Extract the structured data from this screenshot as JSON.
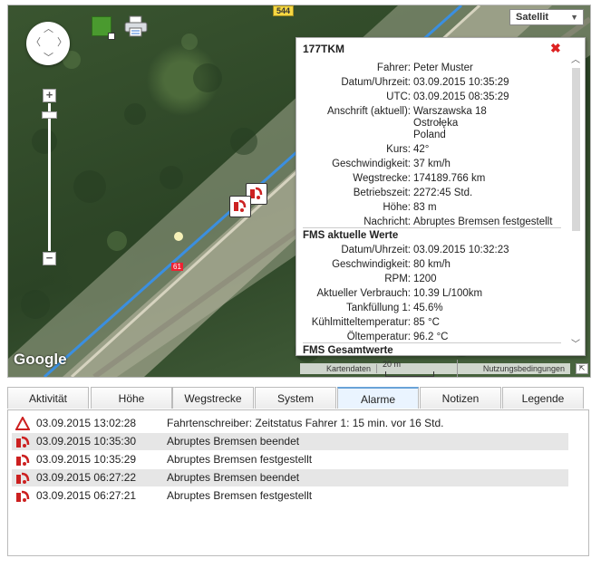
{
  "map": {
    "map_type": "Satellit",
    "road_label_top": "544",
    "road_label_mid": "61",
    "google_logo": "Google",
    "footer": {
      "map_data": "Kartendaten",
      "scale": "20 m",
      "terms": "Nutzungsbedingungen"
    },
    "icons": {
      "pan": "pan-control-icon",
      "zoom_in": "zoom-in-icon",
      "zoom_out": "zoom-out-icon",
      "color_tool": "color-square-icon",
      "print": "printer-icon",
      "vehicle": "harsh-braking-marker-icon"
    }
  },
  "popup": {
    "title": "177TKM",
    "close": "✖",
    "rows": [
      {
        "k": "Fahrer:",
        "v": "Peter Muster"
      },
      {
        "k": "Datum/Uhrzeit:",
        "v": "03.09.2015 10:35:29"
      },
      {
        "k": "UTC:",
        "v": "03.09.2015 08:35:29"
      },
      {
        "k": "Anschrift (aktuell):",
        "v": "Warszawska 18",
        "v2": "Ostrołęka",
        "v3": "Poland"
      },
      {
        "k": "Kurs:",
        "v": "42°"
      },
      {
        "k": "Geschwindigkeit:",
        "v": "37 km/h"
      },
      {
        "k": "Wegstrecke:",
        "v": "174189.766 km"
      },
      {
        "k": "Betriebszeit:",
        "v": "2272:45 Std."
      },
      {
        "k": "Höhe:",
        "v": "83 m"
      },
      {
        "k": "Nachricht:",
        "v": "Abruptes Bremsen festgestellt"
      }
    ],
    "section_fms": "FMS aktuelle Werte",
    "fms_rows": [
      {
        "k": "Datum/Uhrzeit:",
        "v": "03.09.2015 10:32:23"
      },
      {
        "k": "Geschwindigkeit:",
        "v": "80 km/h"
      },
      {
        "k": "RPM:",
        "v": "1200"
      },
      {
        "k": "Aktueller Verbrauch:",
        "v": "10.39 L/100km"
      },
      {
        "k": "Tankfüllung 1:",
        "v": "45.6%"
      },
      {
        "k": "Kühlmitteltemperatur:",
        "v": "85 °C"
      },
      {
        "k": "Öltemperatur:",
        "v": "96.2 °C"
      }
    ],
    "section_total": "FMS Gesamtwerte"
  },
  "tabs": [
    "Aktivität",
    "Höhe",
    "Wegstrecke",
    "System",
    "Alarme",
    "Notizen",
    "Legende"
  ],
  "active_tab": "Alarme",
  "alarms": [
    {
      "icon": "warning-triangle-icon",
      "time": "03.09.2015 13:02:28",
      "msg": "Fahrtenschreiber: Zeitstatus Fahrer 1: 15 min. vor 16 Std."
    },
    {
      "icon": "harsh-braking-icon",
      "time": "03.09.2015 10:35:30",
      "msg": "Abruptes Bremsen beendet"
    },
    {
      "icon": "harsh-braking-icon",
      "time": "03.09.2015 10:35:29",
      "msg": "Abruptes Bremsen festgestellt"
    },
    {
      "icon": "harsh-braking-icon",
      "time": "03.09.2015 06:27:22",
      "msg": "Abruptes Bremsen beendet"
    },
    {
      "icon": "harsh-braking-icon",
      "time": "03.09.2015 06:27:21",
      "msg": "Abruptes Bremsen festgestellt"
    }
  ],
  "colors": {
    "alarm_red": "#cc2020",
    "tab_active_border": "#6aa3d8",
    "road_blue": "#3b8fe0"
  }
}
